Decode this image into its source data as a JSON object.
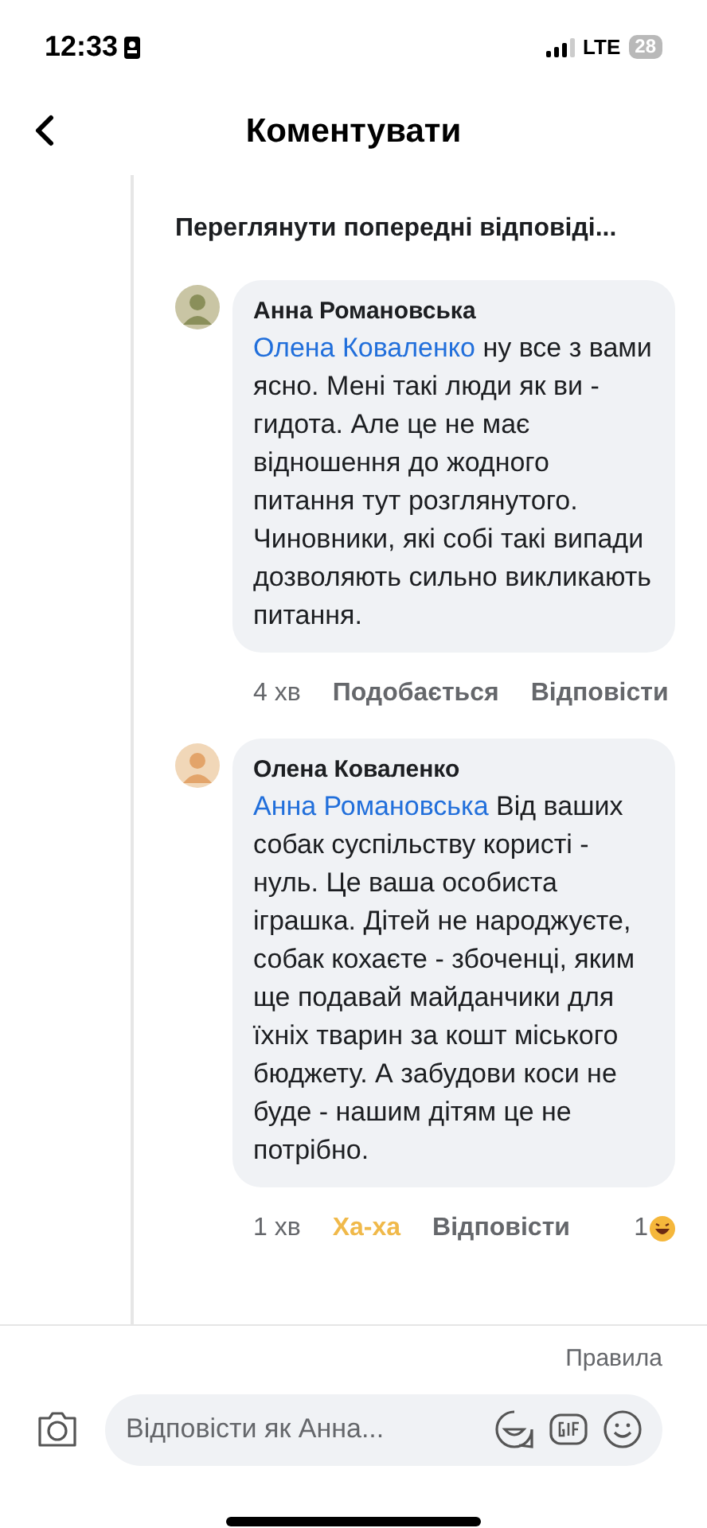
{
  "status_bar": {
    "time": "12:33",
    "network": "LTE",
    "battery": "28"
  },
  "header": {
    "title": "Коментувати"
  },
  "thread": {
    "view_previous": "Переглянути попередні відповіді...",
    "comments": [
      {
        "author": "Анна Романовська",
        "mention": "Олена Коваленко",
        "text": "ну все з вами ясно. Мені такі люди як ви - гидота. Але це не має відношення до жодного питання тут розглянутого. Чиновники, які собі такі випади дозволяють сильно викликають питання.",
        "time": "4 хв",
        "actions": [
          {
            "label": "Подобається",
            "selected": false
          },
          {
            "label": "Відповісти",
            "selected": false
          }
        ]
      },
      {
        "author": "Олена Коваленко",
        "mention": "Анна Романовська",
        "text": "Від ваших собак суспільству користі - нуль. Це ваша особиста іграшка. Дітей не народжуєте, собак кохаєте - збоченці, яким ще подавай майданчики для їхніх тварин за кошт міського бюджету. А забудови коси не буде - нашим дітям це не потрібно.",
        "time": "1 хв",
        "actions": [
          {
            "label": "Ха-ха",
            "selected": true
          },
          {
            "label": "Відповісти",
            "selected": false
          }
        ],
        "reaction_count": "1"
      }
    ]
  },
  "footer": {
    "rules_link": "Правила",
    "reply_field": {
      "placeholder": "Відповісти як Анна..."
    }
  }
}
